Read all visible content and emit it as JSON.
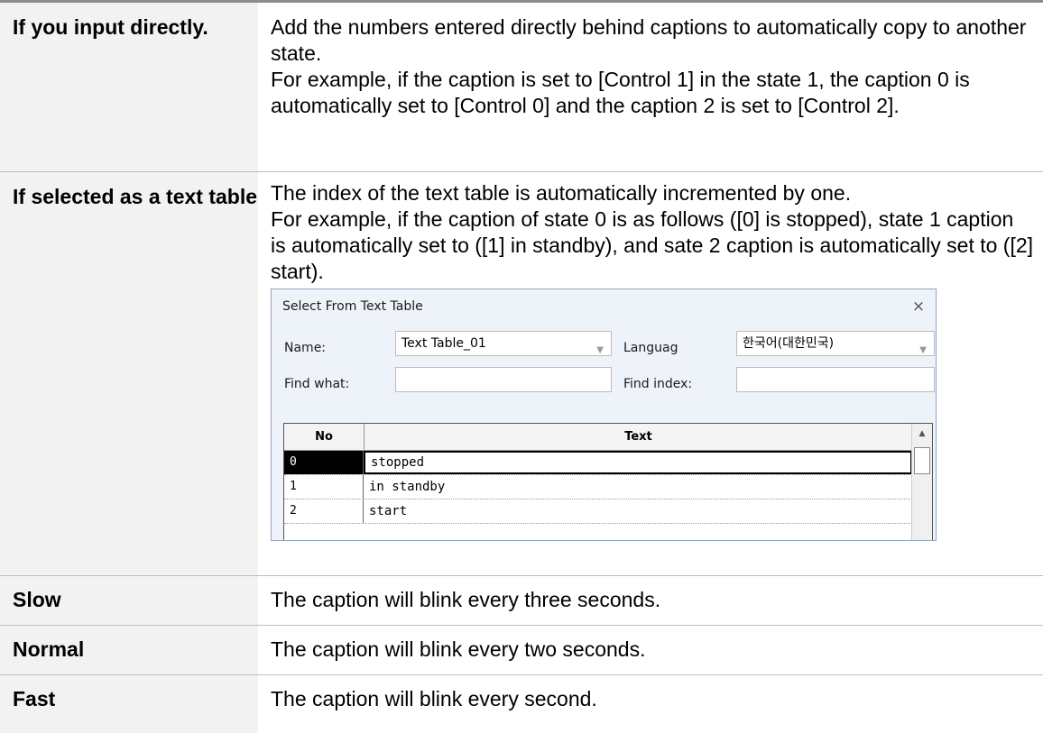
{
  "rows": [
    {
      "label": "If you input directly.",
      "lines": [
        "Add the numbers entered directly behind captions to automatically copy to another state.",
        "For example, if the caption is set to [Control 1] in the state 1, the caption 0 is automatically set to [Control 0] and the caption 2 is set to [Control 2]."
      ]
    },
    {
      "label": "If selected as a text table",
      "lines": [
        "The index of the text table is automatically incremented by one.",
        "For example, if the caption of state 0 is as follows ([0] is stopped), state 1 caption is automatically set to ([1] in standby), and sate 2 caption is automatically set to ([2] start)."
      ]
    },
    {
      "label": "Slow",
      "text": "The caption will blink every three seconds."
    },
    {
      "label": "Normal",
      "text": "The caption will blink every two seconds."
    },
    {
      "label": "Fast",
      "text": "The caption will blink every second."
    }
  ],
  "dialog": {
    "title": "Select From Text Table",
    "close": "×",
    "name_label": "Name:",
    "name_value": "Text Table_01",
    "language_label": "Languag",
    "language_value": "한국어(대한민국)",
    "find_what_label": "Find what:",
    "find_what_value": "",
    "find_index_label": "Find index:",
    "find_index_value": "",
    "grid": {
      "col_no": "No",
      "col_text": "Text",
      "rows": [
        {
          "no": "0",
          "text": "stopped"
        },
        {
          "no": "1",
          "text": "in standby"
        },
        {
          "no": "2",
          "text": "start"
        }
      ]
    }
  }
}
